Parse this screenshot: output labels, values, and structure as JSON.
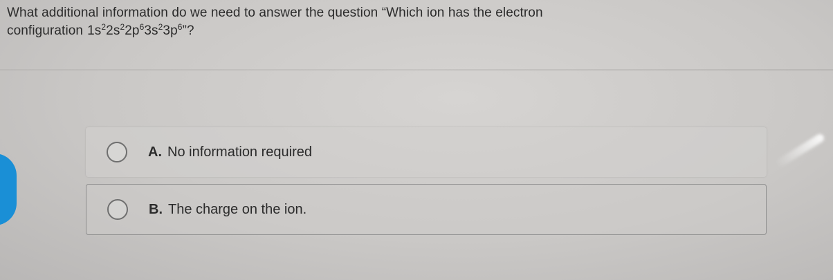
{
  "question": {
    "line1": "What additional information do we need to answer the question “Which ion has the electron",
    "line2_prefix": "configuration",
    "config_terms": [
      {
        "base": "1s",
        "exp": "2"
      },
      {
        "base": "2s",
        "exp": "2"
      },
      {
        "base": "2p",
        "exp": "6"
      },
      {
        "base": "3s",
        "exp": "2"
      },
      {
        "base": "3p",
        "exp": "6"
      }
    ],
    "line2_suffix": "”?"
  },
  "options": [
    {
      "letter": "A.",
      "text": "No information required",
      "selected": false
    },
    {
      "letter": "B.",
      "text": "The charge on the ion.",
      "selected": false
    }
  ],
  "colors": {
    "accent_blue": "#1a8fd6",
    "background": "#cac8c6",
    "text": "#2b2b2b"
  }
}
